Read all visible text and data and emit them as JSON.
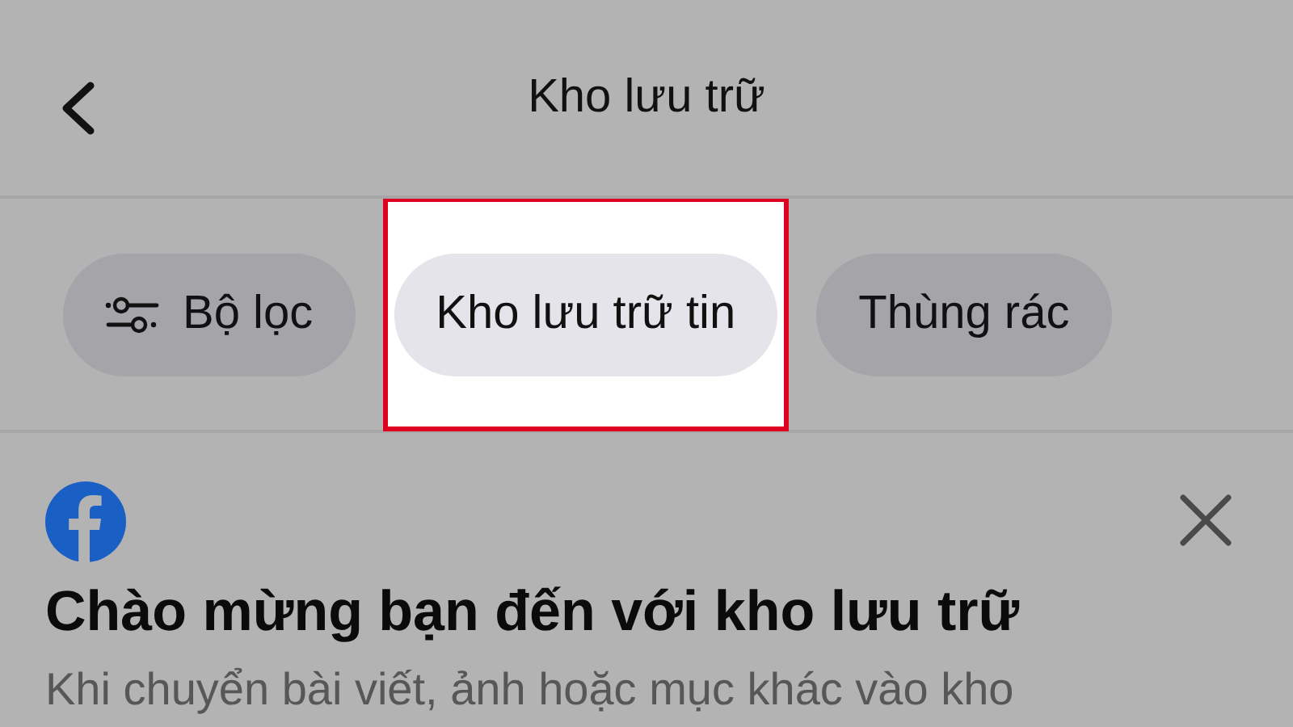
{
  "header": {
    "title": "Kho lưu trữ"
  },
  "chips": [
    {
      "label": "Bộ lọc",
      "kind": "filter",
      "selected": false,
      "highlighted": false
    },
    {
      "label": "Kho lưu trữ tin",
      "kind": "plain",
      "selected": true,
      "highlighted": true
    },
    {
      "label": "Thùng rác",
      "kind": "plain",
      "selected": false,
      "highlighted": false
    }
  ],
  "notice": {
    "title": "Chào mừng bạn đến với kho lưu trữ",
    "body": "Khi chuyển bài viết, ảnh hoặc mục khác vào kho"
  }
}
